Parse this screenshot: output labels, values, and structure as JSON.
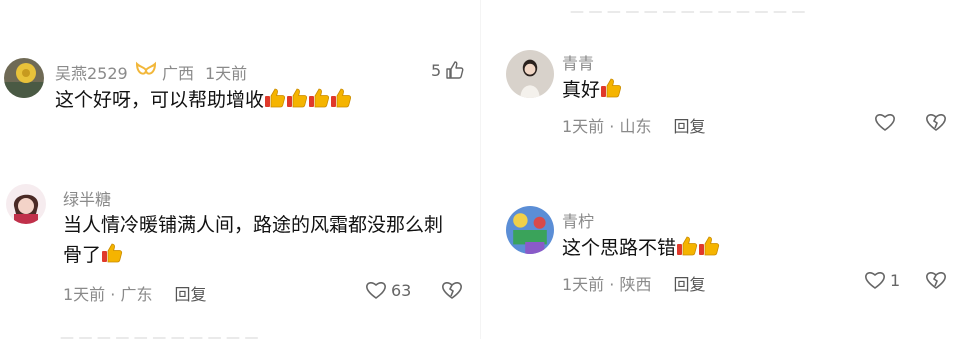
{
  "left": {
    "c1": {
      "name": "吴燕2529",
      "location": "广西",
      "time": "1天前",
      "text": "这个好呀，可以帮助增收",
      "likes": "5",
      "thumbs": 4
    },
    "c2": {
      "name": "绿半糖",
      "text_line1": "当人情冷暖铺满人间，路途的风霜都没那么刺",
      "text_line2": "骨了",
      "time": "1天前",
      "location": "广东",
      "reply": "回复",
      "likes": "63",
      "thumbs": 1
    }
  },
  "right": {
    "c1": {
      "name": "青青",
      "text": "真好",
      "time": "1天前",
      "location": "山东",
      "reply": "回复",
      "thumbs": 1
    },
    "c2": {
      "name": "青柠",
      "text": "这个思路不错",
      "time": "1天前",
      "location": "陕西",
      "reply": "回复",
      "likes": "1",
      "thumbs": 2
    }
  },
  "colors": {
    "name": "#8a8a8a",
    "text": "#111111",
    "thumb": "#f5b400"
  },
  "icons": [
    "thumb-up-icon",
    "heart-icon",
    "dislike-heart-icon",
    "gender-female-icon"
  ]
}
